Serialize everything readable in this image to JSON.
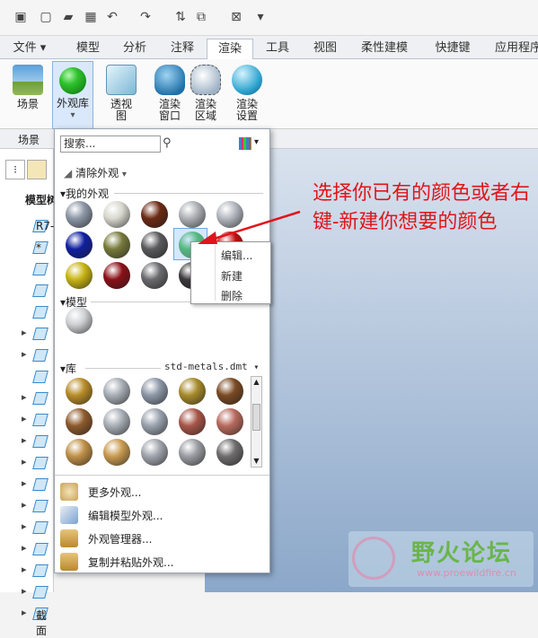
{
  "quick_access": {
    "icons": [
      "window-icon",
      "new-file-icon",
      "open-folder-icon",
      "save-icon",
      "undo-icon",
      "redo-icon",
      "regenerate-icon",
      "windows-icon",
      "close-window-icon",
      "customize-icon"
    ]
  },
  "tabs": [
    "文件",
    "模型",
    "分析",
    "注释",
    "渲染",
    "工具",
    "视图",
    "柔性建模",
    "快捷键",
    "应用程序"
  ],
  "active_tab": "渲染",
  "ribbon": {
    "buttons": [
      {
        "label": "场景"
      },
      {
        "label": "外观库"
      },
      {
        "label": "透视\n图"
      },
      {
        "label": "渲染\n窗口"
      },
      {
        "label": "渲染\n区域"
      },
      {
        "label": "渲染\n设置"
      }
    ],
    "section_label": "场景"
  },
  "tree": {
    "header": "模型树",
    "rows": [
      "R7-",
      "*",
      "",
      "",
      "",
      "",
      "",
      "",
      "",
      "",
      "",
      "",
      "",
      "",
      "",
      "",
      "",
      "",
      "截面"
    ]
  },
  "appearance_panel": {
    "search_placeholder": "搜索...",
    "clear_label": "清除外观",
    "my_appearances_label": "我的外观",
    "model_label": "模型",
    "library_label": "库",
    "library_file": "std-metals.dmt",
    "bottom_items": [
      "更多外观...",
      "编辑模型外观...",
      "外观管理器...",
      "复制并粘贴外观..."
    ]
  },
  "context_menu": {
    "items": [
      "编辑...",
      "新建",
      "删除"
    ]
  },
  "annotation": "选择你已有的颜色或者右键-新建你想要的颜色",
  "watermark": {
    "title": "野火论坛",
    "url": "www.proewildfire.cn"
  },
  "colors": {
    "my": [
      "#8c96a6",
      "#d8d8cf",
      "#6b2a14",
      "#aeb0b6",
      "#b4b8c0",
      "#1020a0",
      "#777a3c",
      "#5a5a5c",
      "#19a81b",
      "#c01010",
      "#c8b414",
      "#8a1018",
      "#6a6a6e",
      "#3a383a"
    ],
    "model": [
      "#cfd1d3"
    ],
    "lib": [
      "#b88c28",
      "#a8aeb6",
      "#8d97a7",
      "#a68a2a",
      "#7a4a24",
      "#8d5a2c",
      "#a8aeb6",
      "#9aa2ae",
      "#a75548",
      "#b86a5e",
      "#c09048",
      "#c89a50",
      "#a0a4ac",
      "#9a9ca2",
      "#6e6c6c"
    ]
  }
}
